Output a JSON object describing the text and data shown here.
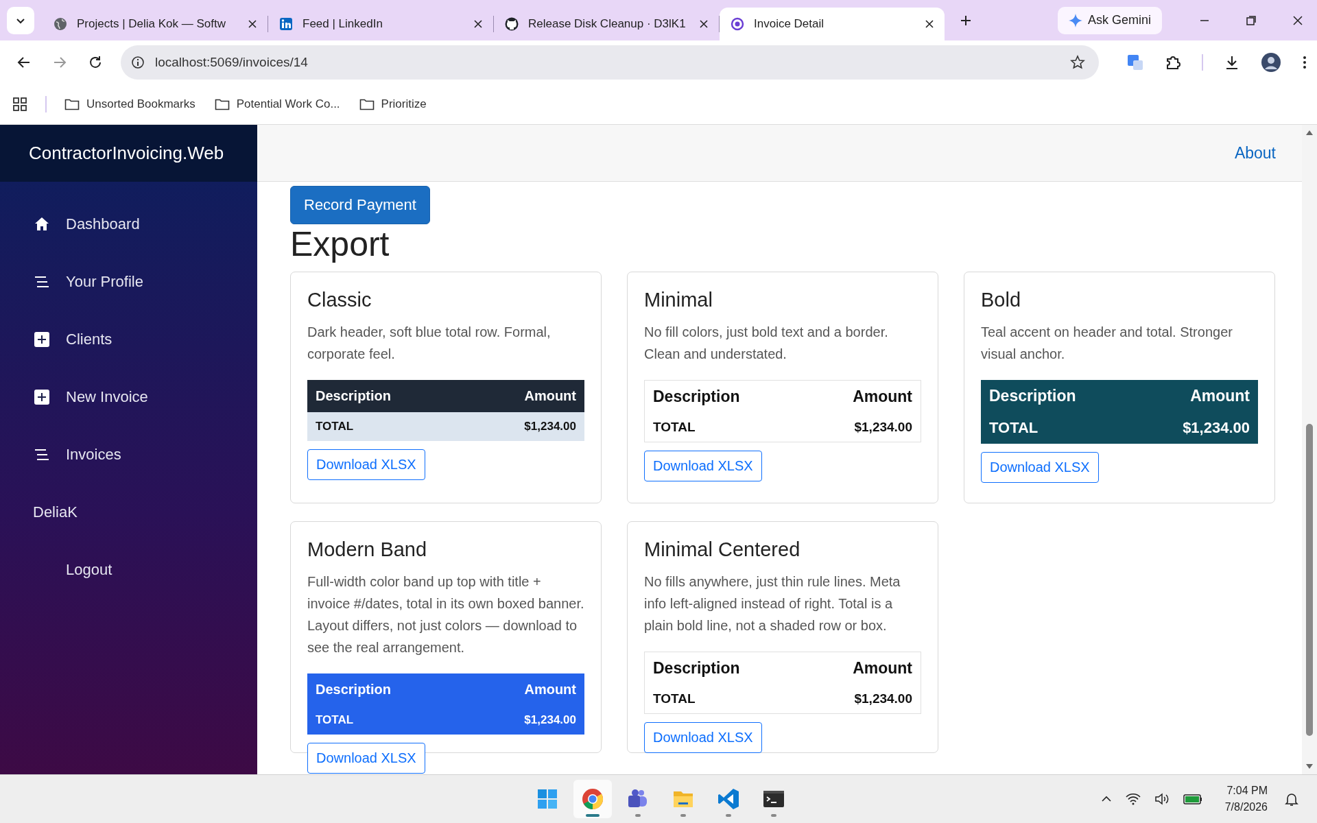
{
  "browser": {
    "tabs": [
      {
        "title": "Projects | Delia Kok — Softw",
        "kind": "globe",
        "selected": false
      },
      {
        "title": "Feed | LinkedIn",
        "kind": "social",
        "selected": false
      },
      {
        "title": "Release Disk Cleanup · D3lK1",
        "kind": "repo",
        "selected": false
      },
      {
        "title": "Invoice Detail",
        "kind": "app",
        "selected": true
      }
    ],
    "gemini": "Ask Gemini",
    "url": "localhost:5069/invoices/14",
    "bookmarks": [
      "Unsorted Bookmarks",
      "Potential Work Co...",
      "Prioritize"
    ]
  },
  "sidebar": {
    "brand": "ContractorInvoicing.Web",
    "items": [
      {
        "label": "Dashboard",
        "kind": "home"
      },
      {
        "label": "Your Profile",
        "kind": "lines"
      },
      {
        "label": "Clients",
        "kind": "plus"
      },
      {
        "label": "New Invoice",
        "kind": "plus"
      },
      {
        "label": "Invoices",
        "kind": "lines"
      },
      {
        "label": "DeliaK",
        "kind": "user"
      },
      {
        "label": "Logout",
        "kind": "action"
      }
    ]
  },
  "topbar": {
    "link": "About"
  },
  "record_button": "Record Payment",
  "heading": "Export",
  "cards": [
    {
      "title": "Classic",
      "description": "Dark header, soft blue total row. Formal, corporate feel.",
      "kind": "classic",
      "header": [
        "Description",
        "Amount"
      ],
      "total": [
        "TOTAL",
        "$1,234.00"
      ],
      "button": "Download XLSX"
    },
    {
      "title": "Minimal",
      "description": "No fill colors, just bold text and a border. Clean and understated.",
      "kind": "minimal",
      "header": [
        "Description",
        "Amount"
      ],
      "total": [
        "TOTAL",
        "$1,234.00"
      ],
      "button": "Download XLSX"
    },
    {
      "title": "Bold",
      "description": "Teal accent on header and total. Stronger visual anchor.",
      "kind": "bold",
      "header": [
        "Description",
        "Amount"
      ],
      "total": [
        "TOTAL",
        "$1,234.00"
      ],
      "button": "Download XLSX"
    },
    {
      "title": "Modern Band",
      "description": "Full-width color band up top with title + invoice #/dates, total in its own boxed banner. Layout differs, not just colors — download to see the real arrangement.",
      "kind": "band",
      "header": [
        "Description",
        "Amount"
      ],
      "total": [
        "TOTAL",
        "$1,234.00"
      ],
      "button": "Download XLSX"
    },
    {
      "title": "Minimal Centered",
      "description": "No fills anywhere, just thin rule lines. Meta info left-aligned instead of right. Total is a plain bold line, not a shaded row or box.",
      "kind": "minimal",
      "header": [
        "Description",
        "Amount"
      ],
      "total": [
        "TOTAL",
        "$1,234.00"
      ],
      "button": "Download XLSX"
    }
  ],
  "taskbar": {
    "apps": [
      {
        "kind": "start",
        "selected": false
      },
      {
        "kind": "browser",
        "selected": true
      },
      {
        "kind": "chat",
        "selected": false
      },
      {
        "kind": "files",
        "selected": false
      },
      {
        "kind": "editor",
        "selected": false
      },
      {
        "kind": "terminal",
        "selected": false
      }
    ],
    "time": "7:04 PM",
    "date": "7/8/2026"
  }
}
